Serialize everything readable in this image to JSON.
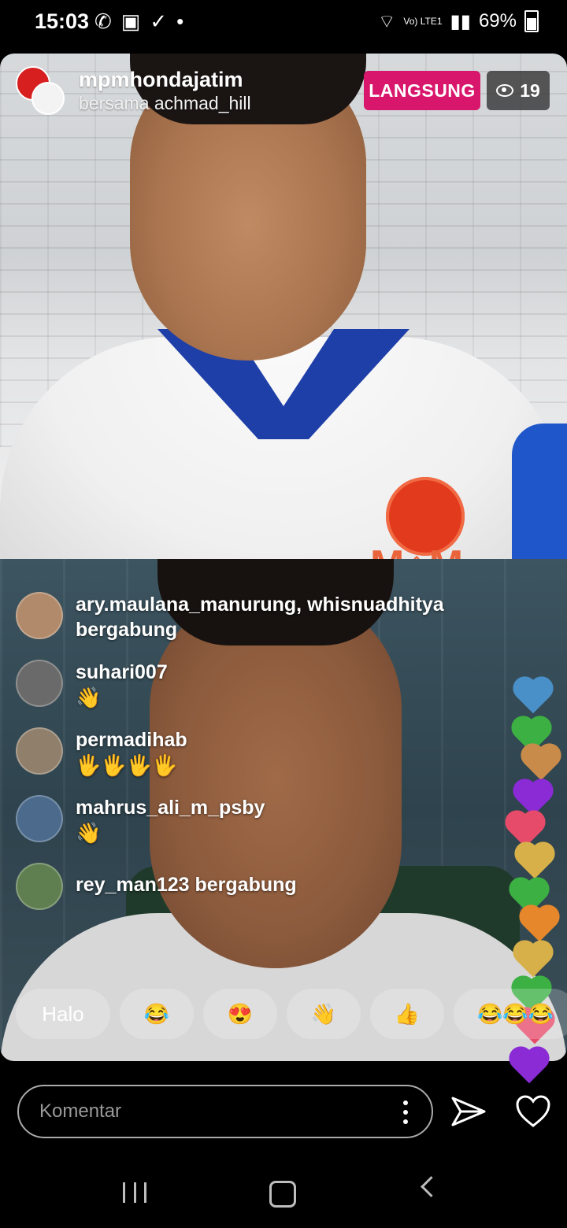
{
  "status_bar": {
    "time": "15:03",
    "network": "Vo) LTE1",
    "battery": "69%"
  },
  "live": {
    "host_username": "mpmhondajatim",
    "with_text": "bersama achmad_hill",
    "live_label": "LANGSUNG",
    "viewer_count": "19"
  },
  "comments": [
    {
      "user": "ary.maulana_manurung, whisnuadhitya",
      "text": "bergabung",
      "avatar_color": "#b08a6a"
    },
    {
      "user": "suhari007",
      "text": "👋",
      "avatar_color": "#6a6a6a"
    },
    {
      "user": "permadihab",
      "text": "🖐🖐🖐🖐",
      "avatar_color": "#8f7f6b"
    },
    {
      "user": "mahrus_ali_m_psby",
      "text": "👋",
      "avatar_color": "#4b6a8c"
    },
    {
      "user": "rey_man123 bergabung",
      "text": "",
      "avatar_color": "#5f7f50"
    }
  ],
  "quick_reactions": [
    {
      "label": "Halo"
    },
    {
      "label": "😂"
    },
    {
      "label": "😍"
    },
    {
      "label": "👋"
    },
    {
      "label": "👍"
    },
    {
      "label": "😂😂😂"
    }
  ],
  "comment_input": {
    "placeholder": "Komentar"
  },
  "hearts_colors": [
    "#4a90c8",
    "#3cb043",
    "#c98b4a",
    "#8a2bd6",
    "#e64b6a",
    "#d8b04a",
    "#3cb043",
    "#e6872c",
    "#d8b04a",
    "#3cb043",
    "#e64b6a",
    "#8a2bd6"
  ],
  "icons": {
    "send": "send-icon",
    "like": "heart-icon",
    "more": "more-vertical-icon"
  }
}
